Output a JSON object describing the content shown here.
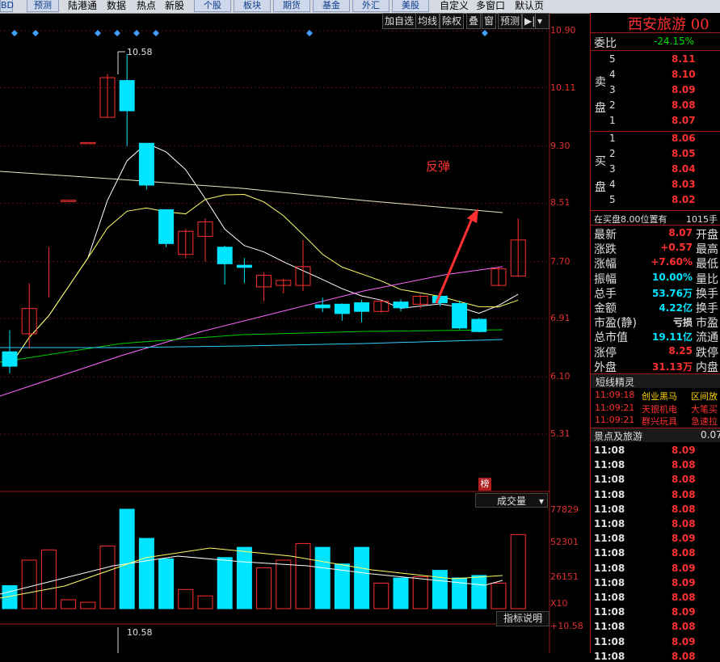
{
  "toolbar": {
    "left_stub": "BD",
    "buttons": [
      "预测"
    ],
    "links": [
      "陆港通",
      "数据",
      "热点",
      "新股"
    ],
    "buttons2": [
      "个股",
      "板块",
      "期货",
      "基金",
      "外汇",
      "美股"
    ],
    "right_links": [
      "自定义",
      "多窗口",
      "默认页"
    ]
  },
  "chart_controls": [
    "加自选",
    "均线",
    "除权",
    "叠",
    "窗",
    "预测",
    "▶|"
  ],
  "annotation": "反弹",
  "price_axis": [
    "10.90",
    "10.11",
    "9.30",
    "8.51",
    "7.70",
    "6.91",
    "6.10",
    "5.31"
  ],
  "high_label": "10.58",
  "volume": {
    "badge": "榜",
    "selector": "成交量",
    "axis": [
      "77829",
      "52301",
      "26151",
      "X10"
    ],
    "indicator_btn": "指标说明"
  },
  "lower_axis": "+10.58",
  "lower_high_label": "10.58",
  "colors": {
    "up": "#ff3030",
    "down": "#00e5ff",
    "ma5": "#ffffff",
    "ma10": "#ffff66",
    "ma20": "#ff66ff",
    "ma60": "#00cc00",
    "ma120": "#33ccff",
    "ma250": "#e8e8c0"
  },
  "chart_data": {
    "type": "candlestick",
    "title": "西安旅游",
    "ylim": [
      5.31,
      10.9
    ],
    "candles": [
      {
        "o": 6.45,
        "c": 6.25,
        "h": 6.75,
        "l": 6.15
      },
      {
        "o": 6.7,
        "c": 7.05,
        "h": 7.4,
        "l": 6.5
      },
      {
        "o": null,
        "c": 7.55,
        "h": 7.9,
        "l": 7.2
      },
      {
        "o": 8.55,
        "c": 8.55,
        "h": 8.55,
        "l": 8.55
      },
      {
        "o": 9.35,
        "c": 9.35,
        "h": 9.35,
        "l": 9.35
      },
      {
        "o": 9.7,
        "c": 10.25,
        "h": 10.3,
        "l": 9.7
      },
      {
        "o": 10.21,
        "c": 9.79,
        "h": 10.58,
        "l": 9.3
      },
      {
        "o": 9.34,
        "c": 8.76,
        "h": 9.34,
        "l": 8.7
      },
      {
        "o": 8.42,
        "c": 7.95,
        "h": 8.42,
        "l": 7.9
      },
      {
        "o": 7.8,
        "c": 8.12,
        "h": 8.15,
        "l": 7.75
      },
      {
        "o": 8.05,
        "c": 8.25,
        "h": 8.3,
        "l": 7.7
      },
      {
        "o": 7.9,
        "c": 7.67,
        "h": 7.92,
        "l": 7.38
      },
      {
        "o": 7.65,
        "c": 7.62,
        "h": 7.75,
        "l": 7.4
      },
      {
        "o": 7.35,
        "c": 7.51,
        "h": 7.55,
        "l": 7.15
      },
      {
        "o": 7.37,
        "c": 7.44,
        "h": 7.46,
        "l": 7.26
      },
      {
        "o": 7.37,
        "c": 7.63,
        "h": 8.0,
        "l": 7.29
      },
      {
        "o": 7.1,
        "c": 7.06,
        "h": 7.2,
        "l": 7.0
      },
      {
        "o": 7.11,
        "c": 6.98,
        "h": 7.12,
        "l": 6.88
      },
      {
        "o": 7.13,
        "c": 7.01,
        "h": 7.17,
        "l": 6.86
      },
      {
        "o": 7.01,
        "c": 7.15,
        "h": 7.17,
        "l": 6.99
      },
      {
        "o": 7.14,
        "c": 7.06,
        "h": 7.18,
        "l": 7.01
      },
      {
        "o": 7.11,
        "c": 7.22,
        "h": 7.24,
        "l": 7.05
      },
      {
        "o": 7.22,
        "c": 7.13,
        "h": 7.26,
        "l": 7.08
      },
      {
        "o": 7.12,
        "c": 6.78,
        "h": 7.16,
        "l": 6.76
      },
      {
        "o": 6.9,
        "c": 6.73,
        "h": 6.92,
        "l": 6.72
      },
      {
        "o": 7.37,
        "c": 7.6,
        "h": 7.62,
        "l": 7.36
      },
      {
        "o": 7.5,
        "c": 8.0,
        "h": 8.3,
        "l": 7.49
      }
    ],
    "volume": [
      18000,
      38000,
      46000,
      7000,
      5000,
      49000,
      77829,
      55000,
      39000,
      15000,
      10000,
      40000,
      48000,
      32000,
      38000,
      51000,
      48000,
      35000,
      48000,
      20000,
      24000,
      25000,
      30000,
      24000,
      26000,
      20000,
      58000
    ]
  },
  "quote": {
    "name": "西安旅游 00",
    "weibi_label": "委比",
    "weibi_value": "-24.15%",
    "sell_label": [
      "卖",
      "盘"
    ],
    "buy_label": [
      "买",
      "盘"
    ],
    "sell": [
      [
        "5",
        "8.11"
      ],
      [
        "4",
        "8.10"
      ],
      [
        "3",
        "8.09"
      ],
      [
        "2",
        "8.08"
      ],
      [
        "1",
        "8.07"
      ]
    ],
    "buy": [
      [
        "1",
        "8.06"
      ],
      [
        "2",
        "8.05"
      ],
      [
        "3",
        "8.04"
      ],
      [
        "4",
        "8.03"
      ],
      [
        "5",
        "8.02"
      ]
    ],
    "position_text": "在买盘8.00位置有",
    "position_qty": "1015手",
    "stats": [
      {
        "label": "最新",
        "value": "8.07",
        "label2": "开盘",
        "vcolor": "red"
      },
      {
        "label": "涨跌",
        "value": "+0.57",
        "label2": "最高",
        "vcolor": "red"
      },
      {
        "label": "涨幅",
        "value": "+7.60%",
        "label2": "最低",
        "vcolor": "red"
      },
      {
        "label": "振幅",
        "value": "10.00%",
        "label2": "量比",
        "vcolor": "cyan"
      },
      {
        "label": "总手",
        "value": "53.76万",
        "label2": "换手",
        "vcolor": "cyan"
      },
      {
        "label": "金额",
        "value": "4.22亿",
        "label2": "换手",
        "vcolor": "cyan"
      },
      {
        "label": "市盈(静)",
        "value": "亏损",
        "label2": "市盈",
        "vcolor": "white"
      },
      {
        "label": "总市值",
        "value": "19.11亿",
        "label2": "流通",
        "vcolor": "cyan"
      },
      {
        "label": "涨停",
        "value": "8.25",
        "label2": "跌停",
        "vcolor": "red"
      },
      {
        "label": "外盘",
        "value": "31.13万",
        "label2": "内盘",
        "vcolor": "red"
      }
    ],
    "sprite_title": "短线精灵",
    "sprites": [
      {
        "time": "11:09:18",
        "name": "创业黑马",
        "event": "区间放",
        "color": "yellow"
      },
      {
        "time": "11:09:21",
        "name": "天银机电",
        "event": "大笔买",
        "color": "red"
      },
      {
        "time": "11:09:21",
        "name": "群兴玩具",
        "event": "急速拉",
        "color": "red"
      }
    ],
    "sector": "景点及旅游",
    "sector_value": "0.07",
    "ticks": [
      [
        "11:08",
        "8.09"
      ],
      [
        "11:08",
        "8.08"
      ],
      [
        "11:08",
        "8.08"
      ],
      [
        "11:08",
        "8.08"
      ],
      [
        "11:08",
        "8.08"
      ],
      [
        "11:08",
        "8.08"
      ],
      [
        "11:08",
        "8.09"
      ],
      [
        "11:08",
        "8.08"
      ],
      [
        "11:08",
        "8.09"
      ],
      [
        "11:08",
        "8.09"
      ],
      [
        "11:08",
        "8.08"
      ],
      [
        "11:08",
        "8.09"
      ],
      [
        "11:08",
        "8.08"
      ],
      [
        "11:08",
        "8.09"
      ],
      [
        "11:08",
        "8.08"
      ]
    ]
  }
}
